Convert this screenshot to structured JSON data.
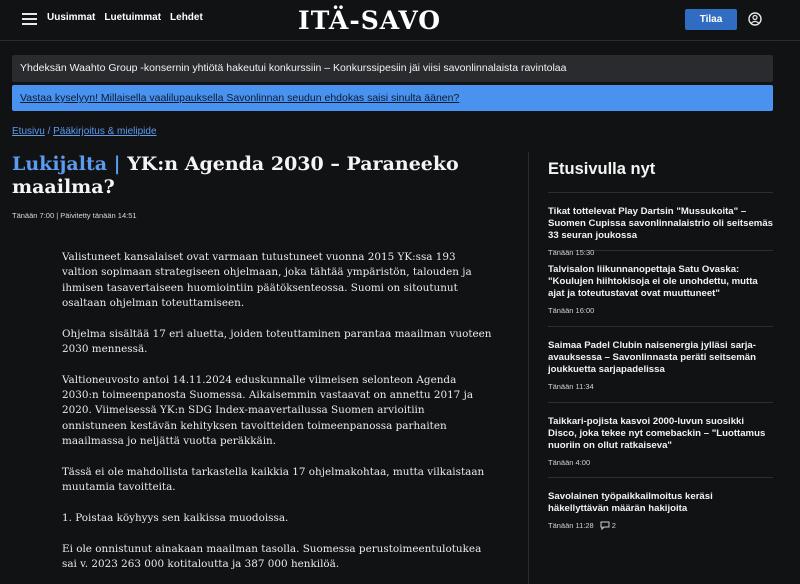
{
  "header": {
    "nav": [
      "Uusimmat",
      "Luetuimmat",
      "Lehdet"
    ],
    "logo": "ITÄ-SAVO",
    "subscribe_label": "Tilaa",
    "icons": {
      "menu": "hamburger-menu-icon",
      "user": "user-icon"
    }
  },
  "banners": {
    "top_story": "Yhdeksän Waahto Group -konsernin yhtiötä hakeutui konkurssiin – Konkurssipesiin jäi viisi savonlinnalaista ravintolaa",
    "poll": "Vastaa kyselyyn! Millaisella vaalilupauksella Savonlinnan seudun ehdokas saisi sinulta äänen?"
  },
  "breadcrumb": {
    "home": "Etusivu",
    "separator": " / ",
    "section": "Pääkirjoitus & mielipide"
  },
  "article": {
    "section": "Lukijalta |",
    "title": "YK:n Agenda 2030 – Paraneeko maailma?",
    "meta": "Tänään 7:00 | Päivitetty tänään 14:51",
    "paragraphs": [
      "Valistuneet kansalaiset ovat varmaan tutustuneet vuonna 2015 YK:ssa 193 valtion sopimaan strategiseen ohjelmaan, joka tähtää ympäristön, talouden ja ihmisen tasavertaiseen huomiointiin päätöksenteossa. Suomi on sitoutunut osaltaan ohjelman toteuttamiseen.",
      "Ohjelma sisältää 17 eri aluetta, joiden toteuttaminen parantaa maailman vuoteen 2030 mennessä.",
      "Valtioneuvosto antoi 14.11.2024 eduskunnalle viimeisen selonteon Agenda 2030:n toimeenpanosta Suomessa. Aikaisemmin vastaavat on annettu 2017 ja 2020. Viimeisessä YK:n SDG Index-maavertailussa Suomen arvioitiin onnistuneen kestävän kehityksen tavoitteiden toimeenpanossa parhaiten maailmassa jo neljättä vuotta peräkkäin.",
      "Tässä ei ole mahdollista tarkastella kaikkia 17 ohjelmakohtaa, mutta vilkaistaan muutamia tavoitteita.",
      "1. Poistaa köyhyys sen kaikissa muodoissa.",
      "Ei ole onnistunut ainakaan maailman tasolla. Suomessa perustoimeentulotukea sai v. 2023 263 000 kotitaloutta ja 387 000 henkilöä."
    ]
  },
  "sidebar": {
    "title": "Etusivulla nyt",
    "items": [
      {
        "headline": "Tikat tottelevat Play Dartsin \"Mussukoita\" – Suomen Cupissa savonlinnalaistrio oli seitsemäs 33 seuran joukossa",
        "time": "Tänään 15:30"
      },
      {
        "headline": "Talvisalon liikunnanopettaja Satu Ovaska: \"Koulujen hiihtokisoja ei ole unohdettu, mutta ajat ja toteutustavat ovat muuttuneet\"",
        "time": "Tänään 16:00"
      },
      {
        "headline": "Saimaa Padel Clubin naisenergia jylläsi sarja-avauksessa – Savonlinnasta peräti seitsemän joukkuetta sarjapadelissa",
        "time": "Tänään 11:34"
      },
      {
        "headline": "Taikkari-pojista kasvoi 2000-luvun suosikki Disco, joka tekee nyt comebackin – \"Luottamus nuoriin on ollut ratkaiseva\"",
        "time": "Tänään 4:00"
      },
      {
        "headline": "Savolainen työpaikkailmoitus keräsi häkellyttävän määrän hakijoita",
        "time": "Tänään 11:28",
        "comments": "2"
      }
    ]
  }
}
